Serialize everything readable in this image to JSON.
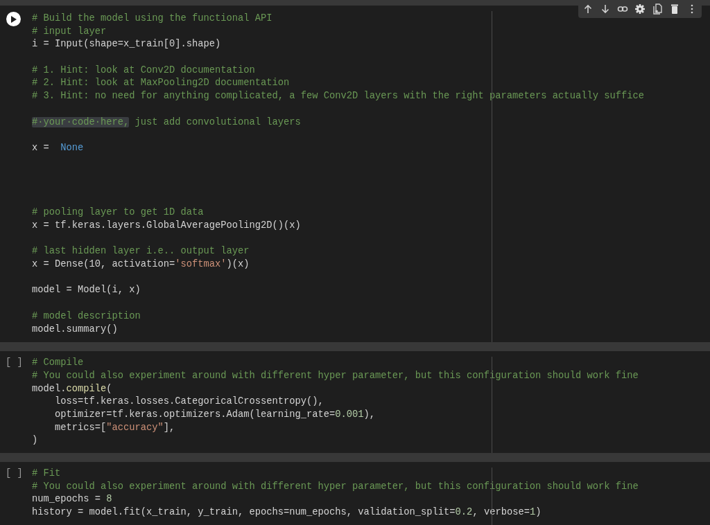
{
  "toolbar": {
    "buttons": [
      {
        "kind": "up"
      },
      {
        "kind": "down"
      },
      {
        "kind": "link"
      },
      {
        "kind": "settings"
      },
      {
        "kind": "mirror"
      },
      {
        "kind": "delete"
      },
      {
        "kind": "more"
      }
    ]
  },
  "cells": [
    {
      "selected": true,
      "lines": [
        {
          "kind": "code",
          "tokens": [
            {
              "kind": "comment",
              "text": "# Build the model using the functional API"
            }
          ]
        },
        {
          "kind": "code",
          "tokens": [
            {
              "kind": "comment",
              "text": "# input layer"
            }
          ]
        },
        {
          "kind": "code",
          "tokens": [
            {
              "kind": "plain",
              "text": "i = Input(shape=x_train[0].shape)"
            }
          ]
        },
        {
          "kind": "blank"
        },
        {
          "kind": "code",
          "tokens": [
            {
              "kind": "comment",
              "text": "# 1. Hint: look at Conv2D documentation"
            }
          ]
        },
        {
          "kind": "code",
          "tokens": [
            {
              "kind": "comment",
              "text": "# 2. Hint: look at MaxPooling2D documentation"
            }
          ]
        },
        {
          "kind": "code",
          "tokens": [
            {
              "kind": "comment",
              "text": "# 3. Hint: no need for anything complicated, a few Conv2D layers with the right parameters actually suffice"
            }
          ]
        },
        {
          "kind": "blank"
        },
        {
          "kind": "code",
          "tokens": [
            {
              "kind": "highlight",
              "text": "#·your·code·here,"
            },
            {
              "kind": "comment",
              "text": " just add convolutional layers"
            }
          ]
        },
        {
          "kind": "blank"
        },
        {
          "kind": "code",
          "tokens": [
            {
              "kind": "plain",
              "text": "x =  "
            },
            {
              "kind": "constant",
              "text": "None"
            }
          ]
        },
        {
          "kind": "blank"
        },
        {
          "kind": "blank"
        },
        {
          "kind": "blank"
        },
        {
          "kind": "blank"
        },
        {
          "kind": "code",
          "tokens": [
            {
              "kind": "comment",
              "text": "# pooling layer to get 1D data"
            }
          ]
        },
        {
          "kind": "code",
          "tokens": [
            {
              "kind": "plain",
              "text": "x = tf.keras.layers.GlobalAveragePooling2D()(x)"
            }
          ]
        },
        {
          "kind": "blank"
        },
        {
          "kind": "code",
          "tokens": [
            {
              "kind": "comment",
              "text": "# last hidden layer i.e.. output layer"
            }
          ]
        },
        {
          "kind": "code",
          "tokens": [
            {
              "kind": "plain",
              "text": "x = Dense(10, activation="
            },
            {
              "kind": "string",
              "text": "'softmax'"
            },
            {
              "kind": "plain",
              "text": ")(x)"
            }
          ]
        },
        {
          "kind": "blank"
        },
        {
          "kind": "code",
          "tokens": [
            {
              "kind": "plain",
              "text": "model = Model(i, x)"
            }
          ]
        },
        {
          "kind": "blank"
        },
        {
          "kind": "code",
          "tokens": [
            {
              "kind": "comment",
              "text": "# model description"
            }
          ]
        },
        {
          "kind": "code",
          "tokens": [
            {
              "kind": "plain",
              "text": "model.summary()"
            }
          ]
        }
      ]
    },
    {
      "selected": false,
      "execution_label": "[ ]",
      "lines": [
        {
          "kind": "code",
          "tokens": [
            {
              "kind": "comment",
              "text": "# Compile"
            }
          ]
        },
        {
          "kind": "code",
          "tokens": [
            {
              "kind": "comment",
              "text": "# You could also experiment around with different hyper parameter, but this configuration should work fine"
            }
          ]
        },
        {
          "kind": "code",
          "tokens": [
            {
              "kind": "plain",
              "text": "model."
            },
            {
              "kind": "function",
              "text": "compile"
            },
            {
              "kind": "plain",
              "text": "("
            }
          ]
        },
        {
          "kind": "code",
          "tokens": [
            {
              "kind": "plain",
              "text": "    loss=tf.keras.losses.CategoricalCrossentropy(),"
            }
          ]
        },
        {
          "kind": "code",
          "tokens": [
            {
              "kind": "plain",
              "text": "    optimizer=tf.keras.optimizers.Adam(learning_rate="
            },
            {
              "kind": "number",
              "text": "0.001"
            },
            {
              "kind": "plain",
              "text": "),"
            }
          ]
        },
        {
          "kind": "code",
          "tokens": [
            {
              "kind": "plain",
              "text": "    metrics=["
            },
            {
              "kind": "string",
              "text": "\"accuracy\""
            },
            {
              "kind": "plain",
              "text": "],"
            }
          ]
        },
        {
          "kind": "code",
          "tokens": [
            {
              "kind": "plain",
              "text": ")"
            }
          ]
        }
      ]
    },
    {
      "selected": false,
      "execution_label": "[ ]",
      "lines": [
        {
          "kind": "code",
          "tokens": [
            {
              "kind": "comment",
              "text": "# Fit"
            }
          ]
        },
        {
          "kind": "code",
          "tokens": [
            {
              "kind": "comment",
              "text": "# You could also experiment around with different hyper parameter, but this configuration should work fine"
            }
          ]
        },
        {
          "kind": "code",
          "tokens": [
            {
              "kind": "plain",
              "text": "num_epochs = "
            },
            {
              "kind": "number",
              "text": "8"
            }
          ]
        },
        {
          "kind": "code",
          "tokens": [
            {
              "kind": "plain",
              "text": "history = model.fit(x_train, y_train, epochs=num_epochs, validation_split="
            },
            {
              "kind": "number",
              "text": "0.2"
            },
            {
              "kind": "plain",
              "text": ", verbose="
            },
            {
              "kind": "number",
              "text": "1"
            },
            {
              "kind": "plain",
              "text": ")"
            }
          ]
        }
      ]
    }
  ]
}
